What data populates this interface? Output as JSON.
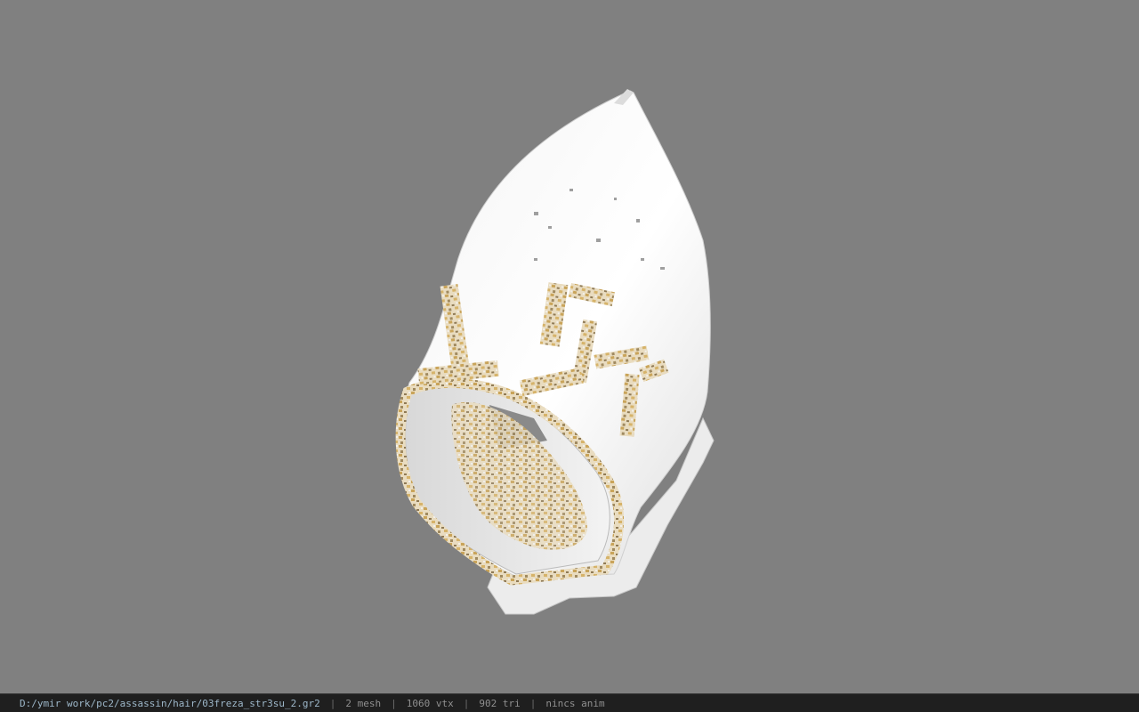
{
  "viewport": {
    "background_color": "#808080",
    "model_icon": "hooded-helmet-model"
  },
  "statusbar": {
    "path": "D:/ymir work/pc2/assassin/hair/03freza_str3su_2.gr2",
    "separator": "|",
    "mesh": "2 mesh",
    "vertices": "1060 vtx",
    "triangles": "902 tri",
    "anim": "nincs anim",
    "background_color": "#1f1f1f",
    "path_color": "#9db7c9",
    "text_color": "#8f8f8f"
  }
}
